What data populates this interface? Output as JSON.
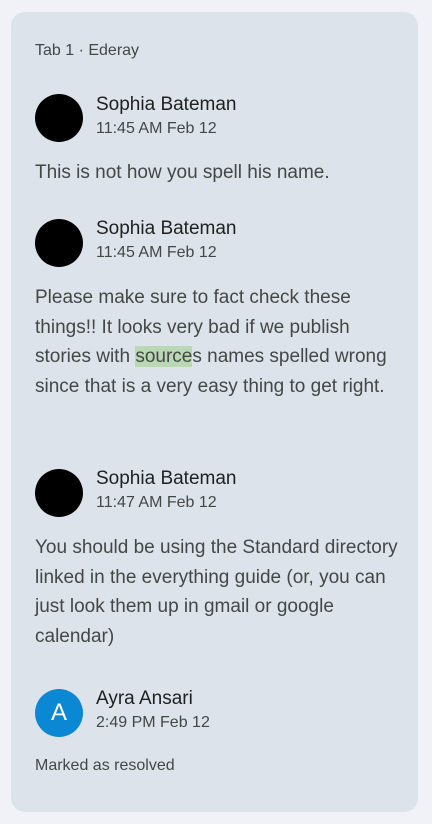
{
  "thread": {
    "tab_label": "Tab 1 · Ederay",
    "comments": [
      {
        "author": "Sophia Bateman",
        "time": "11:45 AM Feb 12",
        "text": "This is not how you spell his name."
      },
      {
        "author": "Sophia Bateman",
        "time": "11:45 AM Feb 12",
        "text_before": "Please make sure to fact check these things!! It looks very bad if we publish stories with ",
        "text_highlight": "source",
        "text_after": "s names spelled wrong since that is a very easy thing to get right."
      },
      {
        "author": "Sophia Bateman",
        "time": "11:47 AM Feb 12",
        "text": "You should be using the Standard directory linked in the everything guide (or, you can just look them up in gmail or google calendar)"
      },
      {
        "author": "Ayra Ansari",
        "time": "2:49 PM Feb 12",
        "avatar_letter": "A"
      }
    ],
    "status": "Marked as resolved"
  },
  "colors": {
    "card_background": "#dde3ea",
    "avatar_blue": "#0b88d3",
    "highlight_green": "#b9d9b4"
  }
}
